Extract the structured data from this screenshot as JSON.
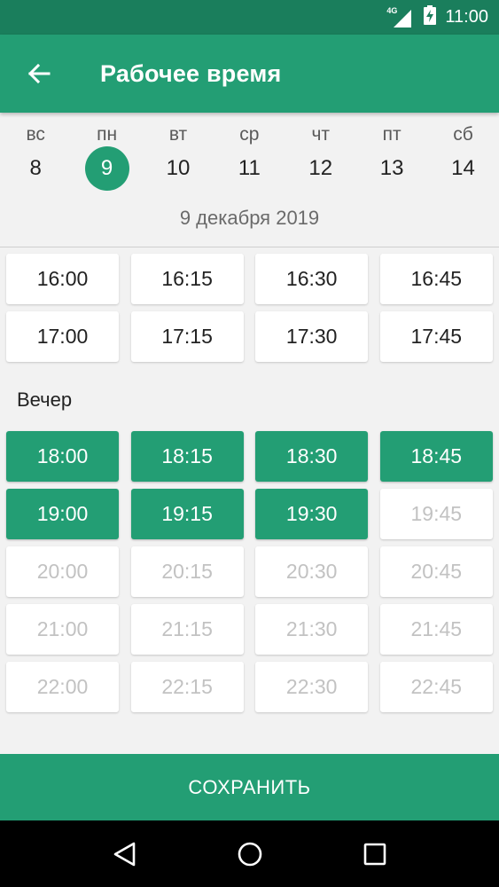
{
  "status": {
    "network": "4G",
    "time": "11:00"
  },
  "appbar": {
    "title": "Рабочее время",
    "back_icon": "arrow-left-icon"
  },
  "week": {
    "days": [
      {
        "name": "вс",
        "date": "8"
      },
      {
        "name": "пн",
        "date": "9",
        "selected": true
      },
      {
        "name": "вт",
        "date": "10"
      },
      {
        "name": "ср",
        "date": "11"
      },
      {
        "name": "чт",
        "date": "12"
      },
      {
        "name": "пт",
        "date": "13"
      },
      {
        "name": "сб",
        "date": "14"
      }
    ],
    "selected_date": "9 декабря 2019"
  },
  "day_slots": [
    {
      "time": "16:00",
      "state": "available"
    },
    {
      "time": "16:15",
      "state": "available"
    },
    {
      "time": "16:30",
      "state": "available"
    },
    {
      "time": "16:45",
      "state": "available"
    },
    {
      "time": "17:00",
      "state": "available"
    },
    {
      "time": "17:15",
      "state": "available"
    },
    {
      "time": "17:30",
      "state": "available"
    },
    {
      "time": "17:45",
      "state": "available"
    }
  ],
  "evening": {
    "label": "Вечер",
    "slots": [
      {
        "time": "18:00",
        "state": "selected"
      },
      {
        "time": "18:15",
        "state": "selected"
      },
      {
        "time": "18:30",
        "state": "selected"
      },
      {
        "time": "18:45",
        "state": "selected"
      },
      {
        "time": "19:00",
        "state": "selected"
      },
      {
        "time": "19:15",
        "state": "selected"
      },
      {
        "time": "19:30",
        "state": "selected"
      },
      {
        "time": "19:45",
        "state": "disabled"
      },
      {
        "time": "20:00",
        "state": "disabled"
      },
      {
        "time": "20:15",
        "state": "disabled"
      },
      {
        "time": "20:30",
        "state": "disabled"
      },
      {
        "time": "20:45",
        "state": "disabled"
      },
      {
        "time": "21:00",
        "state": "disabled"
      },
      {
        "time": "21:15",
        "state": "disabled"
      },
      {
        "time": "21:30",
        "state": "disabled"
      },
      {
        "time": "21:45",
        "state": "disabled"
      },
      {
        "time": "22:00",
        "state": "disabled"
      },
      {
        "time": "22:15",
        "state": "disabled"
      },
      {
        "time": "22:30",
        "state": "disabled"
      },
      {
        "time": "22:45",
        "state": "disabled"
      }
    ]
  },
  "save_button": {
    "label": "СОХРАНИТЬ"
  },
  "colors": {
    "primary": "#239e74",
    "status_bar": "#1a7e5c",
    "disabled_text": "#c2c2c2"
  },
  "navbar": {
    "icons": [
      "back-triangle-icon",
      "home-circle-icon",
      "recents-square-icon"
    ]
  }
}
